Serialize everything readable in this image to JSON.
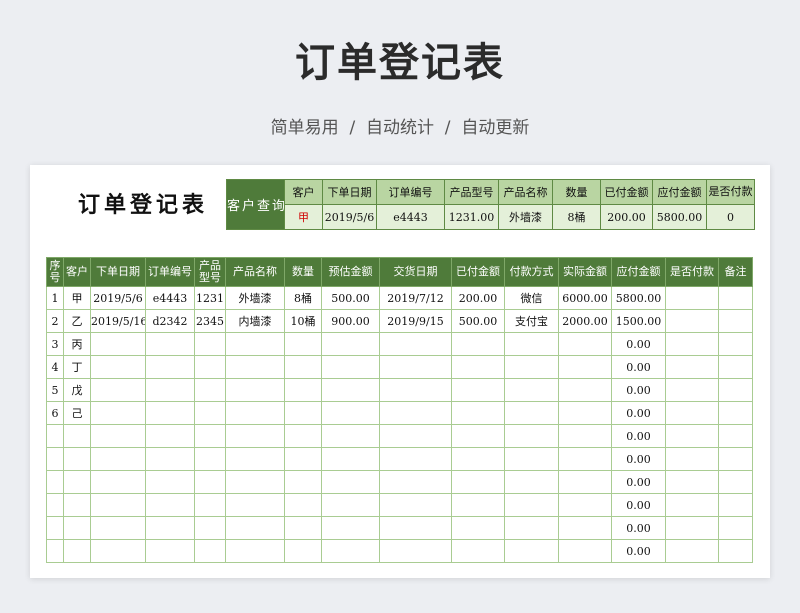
{
  "page": {
    "title": "订单登记表",
    "subtitle": "简单易用  /  自动统计  /  自动更新"
  },
  "sheet": {
    "title": "订单登记表",
    "query": {
      "label": "客户查询",
      "headers": [
        "客户",
        "下单日期",
        "订单编号",
        "产品型号",
        "产品名称",
        "数量",
        "已付金额",
        "应付金额",
        "是否付款"
      ],
      "values": [
        "甲",
        "2019/5/6",
        "e4443",
        "1231.00",
        "外墙漆",
        "8桶",
        "200.00",
        "5800.00",
        "0"
      ]
    },
    "table": {
      "headers": [
        "序号",
        "客户",
        "下单日期",
        "订单编号",
        "产品型号",
        "产品名称",
        "数量",
        "预估金额",
        "交货日期",
        "已付金额",
        "付款方式",
        "实际金额",
        "应付金额",
        "是否付款",
        "备注"
      ],
      "rows": [
        [
          "1",
          "甲",
          "2019/5/6",
          "e4443",
          "1231",
          "外墙漆",
          "8桶",
          "500.00",
          "2019/7/12",
          "200.00",
          "微信",
          "6000.00",
          "5800.00",
          "",
          ""
        ],
        [
          "2",
          "乙",
          "2019/5/16",
          "d2342",
          "2345",
          "内墙漆",
          "10桶",
          "900.00",
          "2019/9/15",
          "500.00",
          "支付宝",
          "2000.00",
          "1500.00",
          "",
          ""
        ],
        [
          "3",
          "丙",
          "",
          "",
          "",
          "",
          "",
          "",
          "",
          "",
          "",
          "",
          "0.00",
          "",
          ""
        ],
        [
          "4",
          "丁",
          "",
          "",
          "",
          "",
          "",
          "",
          "",
          "",
          "",
          "",
          "0.00",
          "",
          ""
        ],
        [
          "5",
          "戊",
          "",
          "",
          "",
          "",
          "",
          "",
          "",
          "",
          "",
          "",
          "0.00",
          "",
          ""
        ],
        [
          "6",
          "己",
          "",
          "",
          "",
          "",
          "",
          "",
          "",
          "",
          "",
          "",
          "0.00",
          "",
          ""
        ],
        [
          "",
          "",
          "",
          "",
          "",
          "",
          "",
          "",
          "",
          "",
          "",
          "",
          "0.00",
          "",
          ""
        ],
        [
          "",
          "",
          "",
          "",
          "",
          "",
          "",
          "",
          "",
          "",
          "",
          "",
          "0.00",
          "",
          ""
        ],
        [
          "",
          "",
          "",
          "",
          "",
          "",
          "",
          "",
          "",
          "",
          "",
          "",
          "0.00",
          "",
          ""
        ],
        [
          "",
          "",
          "",
          "",
          "",
          "",
          "",
          "",
          "",
          "",
          "",
          "",
          "0.00",
          "",
          ""
        ],
        [
          "",
          "",
          "",
          "",
          "",
          "",
          "",
          "",
          "",
          "",
          "",
          "",
          "0.00",
          "",
          ""
        ],
        [
          "",
          "",
          "",
          "",
          "",
          "",
          "",
          "",
          "",
          "",
          "",
          "",
          "0.00",
          "",
          ""
        ]
      ]
    }
  },
  "colors": {
    "header_green": "#4f7b3a",
    "light_green": "#b9d5a2",
    "value_green": "#e4f0d9",
    "grid_green": "#a9cc92",
    "highlight_red": "#d00000"
  }
}
